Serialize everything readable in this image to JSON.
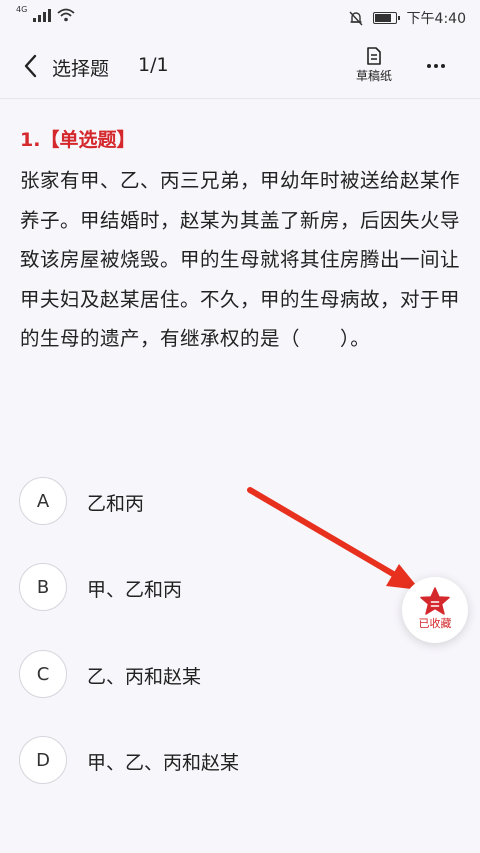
{
  "status_bar": {
    "network": "4G",
    "time": "下午4:40",
    "battery_level": 0.85
  },
  "nav": {
    "title": "选择题",
    "page_count": "1/1",
    "draft_label": "草稿纸"
  },
  "question": {
    "type_label": "1.【单选题】",
    "text": "张家有甲、乙、丙三兄弟，甲幼年时被送给赵某作养子。甲结婚时，赵某为其盖了新房，后因失火导致该房屋被烧毁。甲的生母就将其住房腾出一间让甲夫妇及赵某居住。不久，甲的生母病故，对于甲的生母的遗产，有继承权的是（　　）。"
  },
  "options": [
    {
      "letter": "A",
      "text": "乙和丙"
    },
    {
      "letter": "B",
      "text": "甲、乙和丙"
    },
    {
      "letter": "C",
      "text": "乙、丙和赵某"
    },
    {
      "letter": "D",
      "text": "甲、乙、丙和赵某"
    }
  ],
  "favorite": {
    "label": "已收藏",
    "color": "#d4282c"
  },
  "colors": {
    "accent": "#d4282c",
    "background": "#f7f6fb"
  }
}
